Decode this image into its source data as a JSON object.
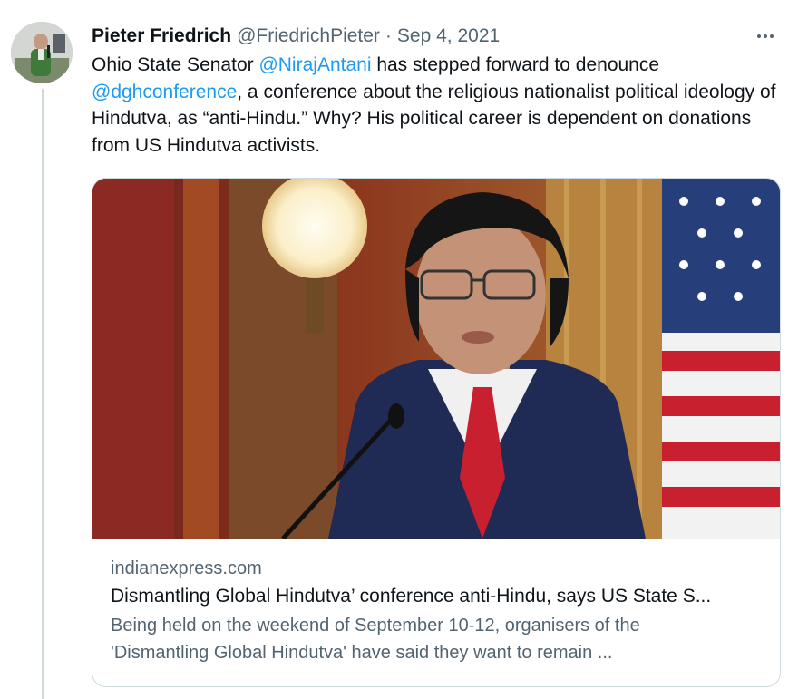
{
  "tweet": {
    "display_name": "Pieter Friedrich",
    "handle": "@FriedrichPieter",
    "separator": "·",
    "date": "Sep 4, 2021",
    "text_part1": "Ohio State Senator ",
    "mention1": "@NirajAntani",
    "text_part2": " has stepped forward to denounce ",
    "mention2": "@dghconference",
    "text_part3": ", a conference about the religious nationalist political ideology of Hindutva, as “anti-Hindu.” Why? His political career is dependent on donations from US Hindutva activists."
  },
  "card": {
    "domain": "indianexpress.com",
    "title": "Dismantling Global Hindutva’ conference anti-Hindu, says US State S...",
    "description_line1": "Being held on the weekend of September 10-12, organisers of the",
    "description_line2": "'Dismantling Global Hindutva' have said they want to remain ..."
  },
  "icons": {
    "more": "more-horizontal-icon"
  },
  "colors": {
    "link": "#1d9bf0",
    "secondary_text": "#536471",
    "border": "#cfd9de"
  }
}
